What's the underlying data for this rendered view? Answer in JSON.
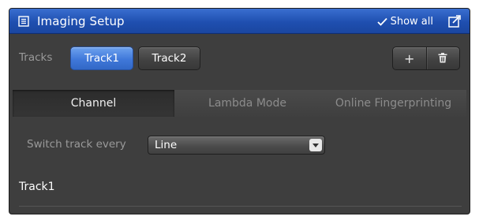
{
  "window": {
    "title": "Imaging Setup",
    "title_icon": "panel-icon",
    "show_all_label": "Show all",
    "undock_icon": "undock-icon"
  },
  "tracks": {
    "label": "Tracks",
    "items": [
      {
        "label": "Track1",
        "selected": true
      },
      {
        "label": "Track2",
        "selected": false
      }
    ],
    "add_label": "+",
    "delete_icon": "trash-icon"
  },
  "modes": {
    "tabs": [
      {
        "label": "Channel",
        "selected": true
      },
      {
        "label": "Lambda Mode",
        "selected": false
      },
      {
        "label": "Online Fingerprinting",
        "selected": false
      }
    ]
  },
  "switch_track": {
    "label": "Switch track every",
    "value": "Line"
  },
  "section": {
    "title": "Track1"
  },
  "colors": {
    "titlebar": "#1f4fb0",
    "accent": "#3f78da",
    "panel_bg": "#3e3e3e"
  }
}
